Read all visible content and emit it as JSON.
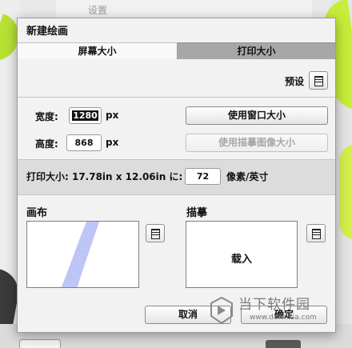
{
  "background": {
    "top_menu_text": "设置"
  },
  "dialog": {
    "title": "新建绘画",
    "tabs": [
      {
        "label": "屏幕大小",
        "active": true
      },
      {
        "label": "打印大小",
        "active": false
      }
    ],
    "preset_label": "预设",
    "width_label": "宽度:",
    "width_value": "1280",
    "height_label": "高度:",
    "height_value": "868",
    "unit_px": "px",
    "use_window_size_label": "使用窗口大小",
    "use_trace_image_size_label": "使用描摹图像大小",
    "print_size_text": "打印大小: 17.78in x 12.06in に:",
    "dpi_value": "72",
    "dpi_unit": "像素/英寸",
    "canvas_title": "画布",
    "trace_title": "描摹",
    "load_label": "载入",
    "cancel_label": "取消",
    "ok_label": "确定"
  },
  "watermark": {
    "brand_cn": "当下软件园",
    "url": "www.downxia.com"
  },
  "colors": {
    "accent_green": "#c8ec3a",
    "stroke_blue": "#5a6ae0",
    "tab_inactive": "#a7a7a7"
  }
}
